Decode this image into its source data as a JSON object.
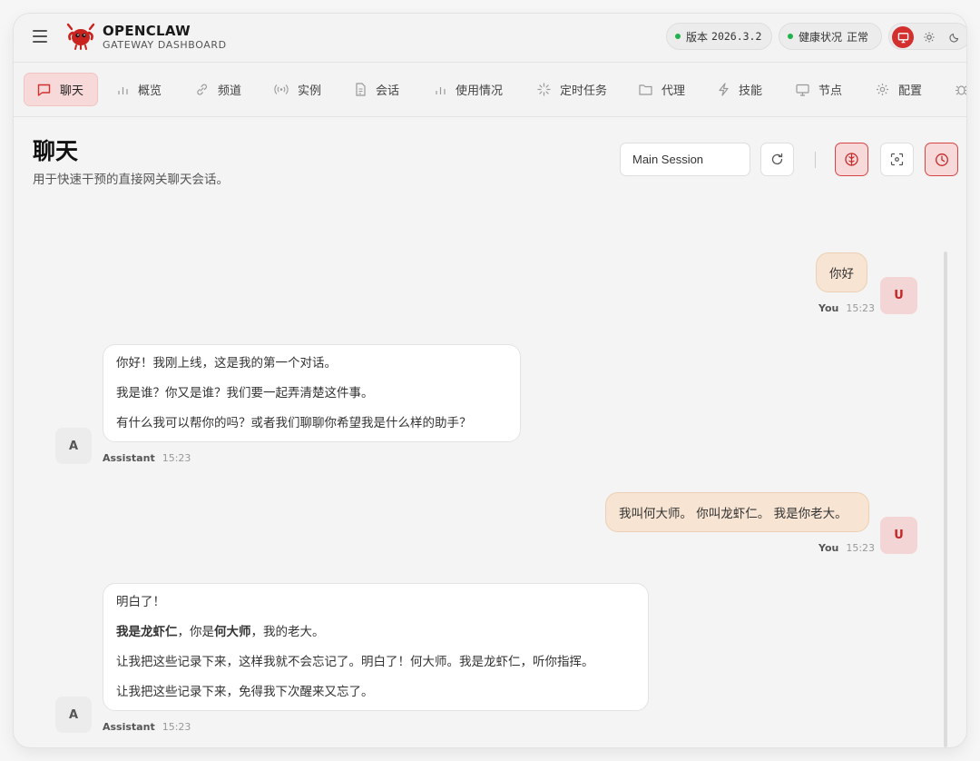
{
  "brand": {
    "title": "OPENCLAW",
    "subtitle": "GATEWAY DASHBOARD"
  },
  "status": {
    "version_label": "版本",
    "version_value": "2026.3.2",
    "health_label": "健康状况",
    "health_value": "正常",
    "status_color": "#22b14c"
  },
  "theme": {
    "options": [
      "monitor-icon",
      "sun-icon",
      "moon-icon"
    ],
    "active": "monitor-icon",
    "accent": "#d32f2f"
  },
  "nav": {
    "items": [
      {
        "label": "聊天",
        "icon": "chat-icon",
        "active": true
      },
      {
        "label": "概览",
        "icon": "bar-chart-icon"
      },
      {
        "label": "频道",
        "icon": "link-icon"
      },
      {
        "label": "实例",
        "icon": "radio-icon"
      },
      {
        "label": "会话",
        "icon": "document-icon"
      },
      {
        "label": "使用情况",
        "icon": "bar-chart-icon"
      },
      {
        "label": "定时任务",
        "icon": "loader-icon"
      },
      {
        "label": "代理",
        "icon": "folder-icon"
      },
      {
        "label": "技能",
        "icon": "lightning-icon"
      },
      {
        "label": "节点",
        "icon": "monitor-icon"
      },
      {
        "label": "配置",
        "icon": "gear-icon"
      }
    ]
  },
  "page": {
    "title": "聊天",
    "subtitle": "用于快速干预的直接网关聊天会话。",
    "session": "Main Session"
  },
  "chat": {
    "messages": [
      {
        "role": "user",
        "avatar": "U",
        "sender": "You",
        "time": "15:23",
        "lines": [
          "你好"
        ]
      },
      {
        "role": "assistant",
        "avatar": "A",
        "sender": "Assistant",
        "time": "15:23",
        "lines": [
          "你好！我刚上线，这是我的第一个对话。",
          "我是谁？你又是谁？我们要一起弄清楚这件事。",
          "有什么我可以帮你的吗？或者我们聊聊你希望我是什么样的助手？"
        ]
      },
      {
        "role": "user",
        "avatar": "U",
        "sender": "You",
        "time": "15:23",
        "lines": [
          "我叫何大师。 你叫龙虾仁。 我是你老大。"
        ]
      },
      {
        "role": "assistant",
        "avatar": "A",
        "sender": "Assistant",
        "time": "15:23",
        "lines": [
          "明白了！",
          "我是龙虾仁",
          "，你是",
          "何大师",
          "，我的老大。",
          "让我把这些记录下来，这样我就不会忘记了。明白了！何大师。我是龙虾仁，听你指挥。",
          "让我把这些记录下来，免得我下次醒来又忘了。"
        ]
      }
    ]
  }
}
